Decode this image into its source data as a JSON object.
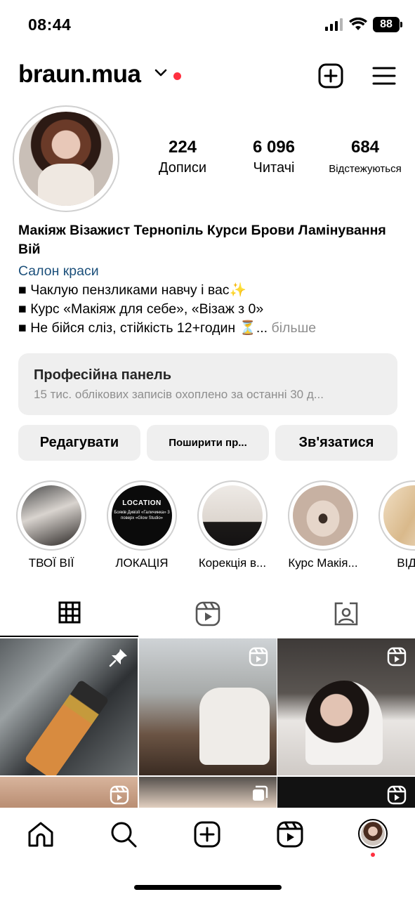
{
  "status_bar": {
    "time": "08:44",
    "battery": "88"
  },
  "header": {
    "username": "braun.mua"
  },
  "stats": [
    {
      "value": "224",
      "label": "Дописи"
    },
    {
      "value": "6 096",
      "label": "Читачі"
    },
    {
      "value": "684",
      "label": "Відстежуються"
    }
  ],
  "bio": {
    "name": "Макіяж Візажист Тернопіль Курси Брови Ламінування Вій",
    "category": "Салон краси",
    "lines": [
      "■ Чаклую пензликами навчу і вас✨",
      "■ Курс «Макіяж для себе», «Візаж з 0»",
      "■ Не бійся сліз, стійкість 12+годин ⏳..."
    ],
    "more": "більше"
  },
  "pro_panel": {
    "title": "Професійна панель",
    "subtitle": "15 тис. облікових записів охоплено за останні 30 д..."
  },
  "actions": {
    "edit": "Редагувати",
    "share": "Поширити пр...",
    "contact": "Зв'язатися"
  },
  "highlights": [
    {
      "label": "ТВОЇ ВІЇ"
    },
    {
      "label": "ЛОКАЦІЯ",
      "cover_title": "LOCATION",
      "cover_text": "Бояків Дивізії «Галичинка» 3 поверх «Glow Studio»"
    },
    {
      "label": "Корекція в..."
    },
    {
      "label": "Курс Макія..."
    },
    {
      "label": "ВІДГУ"
    }
  ],
  "tabs": [
    "grid-icon",
    "reels-icon",
    "tagged-icon"
  ],
  "grid_posts": [
    {
      "badge": "pin-icon"
    },
    {
      "badge": "reel-icon"
    },
    {
      "badge": "reel-icon"
    },
    {
      "badge": "reel-icon"
    },
    {
      "badge": "carousel-icon"
    },
    {
      "badge": "reel-icon"
    }
  ],
  "bottom_nav": [
    "home-icon",
    "search-icon",
    "create-icon",
    "reels-icon",
    "profile-avatar"
  ],
  "colors": {
    "accent_red": "#ff3040",
    "link_blue": "#1b4f7a",
    "panel_grey": "#efefef",
    "muted_text": "#8e8e8e"
  }
}
